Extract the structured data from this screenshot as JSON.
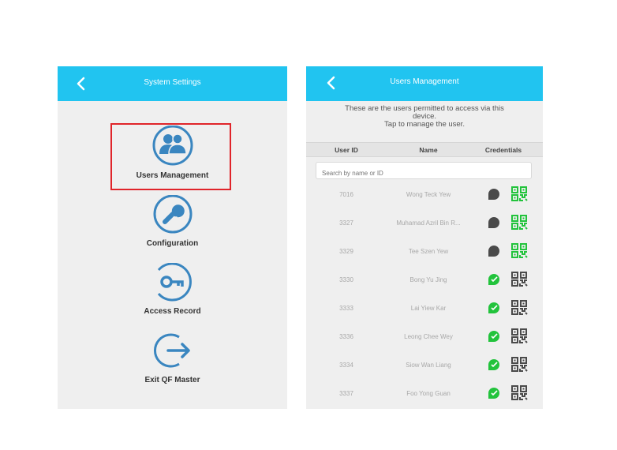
{
  "left_screen": {
    "title": "System Settings",
    "menu": [
      {
        "label": "Users Management",
        "icon": "users-icon"
      },
      {
        "label": "Configuration",
        "icon": "wrench-icon"
      },
      {
        "label": "Access Record",
        "icon": "key-icon"
      },
      {
        "label": "Exit QF Master",
        "icon": "exit-arrow-icon"
      }
    ],
    "highlight_color": "#e0242a"
  },
  "right_screen": {
    "title": "Users Management",
    "intro": [
      "These are the users permitted to access via this",
      "device.",
      "Tap to manage the user."
    ],
    "columns": [
      "User ID",
      "Name",
      "Credentials"
    ],
    "search": {
      "placeholder": "Search by name or ID"
    },
    "users": [
      {
        "id": "7016",
        "name": "Wong Teck Yew",
        "face": "registered",
        "qr": "enabled"
      },
      {
        "id": "3327",
        "name": "Muhamad Azril Bin R...",
        "face": "registered",
        "qr": "enabled"
      },
      {
        "id": "3329",
        "name": "Tee Szen Yew",
        "face": "registered",
        "qr": "enabled"
      },
      {
        "id": "3330",
        "name": "Bong Yu Jing",
        "face": "enabled",
        "qr": "registered"
      },
      {
        "id": "3333",
        "name": "Lai Yiew Kar",
        "face": "enabled",
        "qr": "registered"
      },
      {
        "id": "3336",
        "name": "Leong Chee Wey",
        "face": "enabled",
        "qr": "registered"
      },
      {
        "id": "3334",
        "name": "Siow Wan Liang",
        "face": "enabled",
        "qr": "registered"
      },
      {
        "id": "3337",
        "name": "Foo Yong Guan",
        "face": "enabled",
        "qr": "registered"
      }
    ]
  },
  "colors": {
    "accent": "#21c4f0",
    "icon_blue": "#3a86c0",
    "green": "#22c33c",
    "dark_gray": "#4a4a4a",
    "highlight": "#e0242a"
  }
}
